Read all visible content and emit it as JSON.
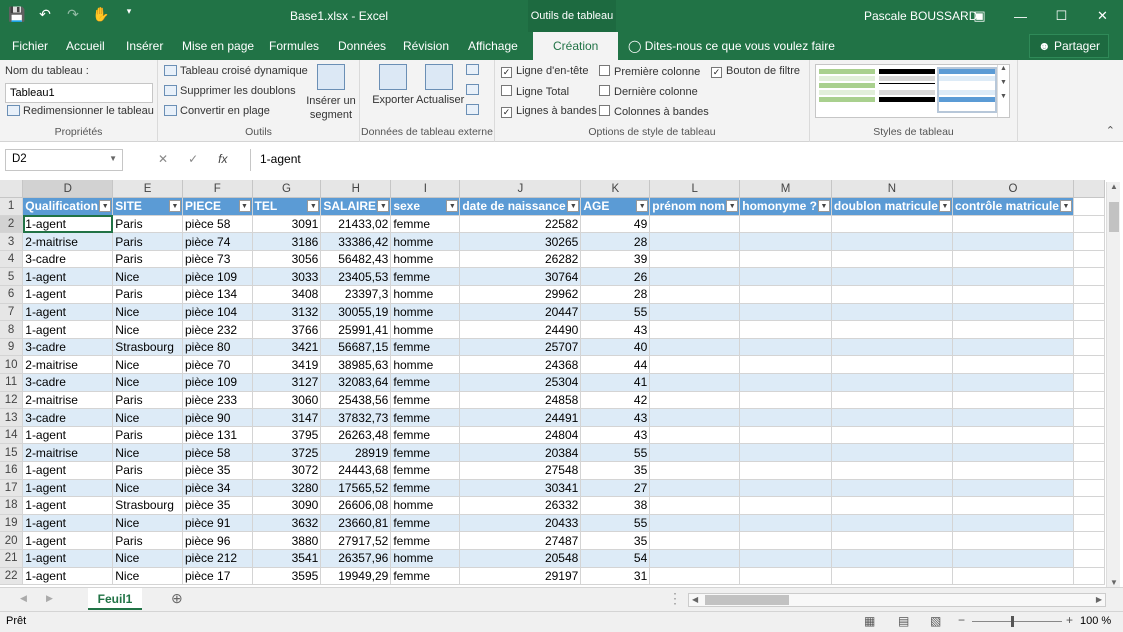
{
  "titlebar": {
    "doc_title": "Base1.xlsx - Excel",
    "context_tab": "Outils de tableau",
    "user": "Pascale BOUSSARD"
  },
  "tabs": [
    "Fichier",
    "Accueil",
    "Insérer",
    "Mise en page",
    "Formules",
    "Données",
    "Révision",
    "Affichage",
    "Création"
  ],
  "tell_me": "Dites-nous ce que vous voulez faire",
  "share": "Partager",
  "ribbon": {
    "proprietes": {
      "label": "Propriétés",
      "name_label": "Nom du tableau :",
      "name_value": "Tableau1",
      "resize": "Redimensionner le tableau"
    },
    "outils": {
      "label": "Outils",
      "pivot": "Tableau croisé dynamique",
      "dedupe": "Supprimer les doublons",
      "convert": "Convertir en plage",
      "slicer": "Insérer un segment"
    },
    "externe": {
      "label": "Données de tableau externe",
      "export": "Exporter",
      "refresh": "Actualiser"
    },
    "options": {
      "label": "Options de style de tableau",
      "header_row": "Ligne d'en-tête",
      "total_row": "Ligne Total",
      "banded_rows": "Lignes à bandes",
      "first_col": "Première colonne",
      "last_col": "Dernière colonne",
      "banded_cols": "Colonnes à bandes",
      "filter_btn": "Bouton de filtre"
    },
    "styles": {
      "label": "Styles de tableau"
    }
  },
  "formula_bar": {
    "name_box": "D2",
    "formula": "1-agent"
  },
  "sheet": {
    "col_letters": [
      "D",
      "E",
      "F",
      "G",
      "H",
      "I",
      "J",
      "K",
      "L",
      "M",
      "N",
      "O"
    ],
    "headers": [
      "Qualification",
      "SITE",
      "PIECE",
      "TEL",
      "SALAIRE",
      "sexe",
      "date de naissance",
      "AGE",
      "prénom nom",
      "homonyme ?",
      "doublon matricule",
      "contrôle matricule"
    ],
    "rows": [
      [
        "1-agent",
        "Paris",
        "pièce 58",
        "3091",
        "21433,02",
        "femme",
        "22582",
        "49"
      ],
      [
        "2-maitrise",
        "Paris",
        "pièce 74",
        "3186",
        "33386,42",
        "homme",
        "30265",
        "28"
      ],
      [
        "3-cadre",
        "Paris",
        "pièce 73",
        "3056",
        "56482,43",
        "homme",
        "26282",
        "39"
      ],
      [
        "1-agent",
        "Nice",
        "pièce 109",
        "3033",
        "23405,53",
        "femme",
        "30764",
        "26"
      ],
      [
        "1-agent",
        "Paris",
        "pièce 134",
        "3408",
        "23397,3",
        "homme",
        "29962",
        "28"
      ],
      [
        "1-agent",
        "Nice",
        "pièce 104",
        "3132",
        "30055,19",
        "homme",
        "20447",
        "55"
      ],
      [
        "1-agent",
        "Nice",
        "pièce 232",
        "3766",
        "25991,41",
        "homme",
        "24490",
        "43"
      ],
      [
        "3-cadre",
        "Strasbourg",
        "pièce 80",
        "3421",
        "56687,15",
        "femme",
        "25707",
        "40"
      ],
      [
        "2-maitrise",
        "Nice",
        "pièce 70",
        "3419",
        "38985,63",
        "homme",
        "24368",
        "44"
      ],
      [
        "3-cadre",
        "Nice",
        "pièce 109",
        "3127",
        "32083,64",
        "femme",
        "25304",
        "41"
      ],
      [
        "2-maitrise",
        "Paris",
        "pièce 233",
        "3060",
        "25438,56",
        "femme",
        "24858",
        "42"
      ],
      [
        "3-cadre",
        "Nice",
        "pièce 90",
        "3147",
        "37832,73",
        "femme",
        "24491",
        "43"
      ],
      [
        "1-agent",
        "Paris",
        "pièce 131",
        "3795",
        "26263,48",
        "femme",
        "24804",
        "43"
      ],
      [
        "2-maitrise",
        "Nice",
        "pièce 58",
        "3725",
        "28919",
        "femme",
        "20384",
        "55"
      ],
      [
        "1-agent",
        "Paris",
        "pièce 35",
        "3072",
        "24443,68",
        "femme",
        "27548",
        "35"
      ],
      [
        "1-agent",
        "Nice",
        "pièce 34",
        "3280",
        "17565,52",
        "femme",
        "30341",
        "27"
      ],
      [
        "1-agent",
        "Strasbourg",
        "pièce 35",
        "3090",
        "26606,08",
        "homme",
        "26332",
        "38"
      ],
      [
        "1-agent",
        "Nice",
        "pièce 91",
        "3632",
        "23660,81",
        "femme",
        "20433",
        "55"
      ],
      [
        "1-agent",
        "Paris",
        "pièce 96",
        "3880",
        "27917,52",
        "femme",
        "27487",
        "35"
      ],
      [
        "1-agent",
        "Nice",
        "pièce 212",
        "3541",
        "26357,96",
        "homme",
        "20548",
        "54"
      ],
      [
        "1-agent",
        "Nice",
        "pièce 17",
        "3595",
        "19949,29",
        "femme",
        "29197",
        "31"
      ]
    ]
  },
  "sheet_tab": "Feuil1",
  "status": {
    "left": "Prêt",
    "zoom": "100 %"
  }
}
